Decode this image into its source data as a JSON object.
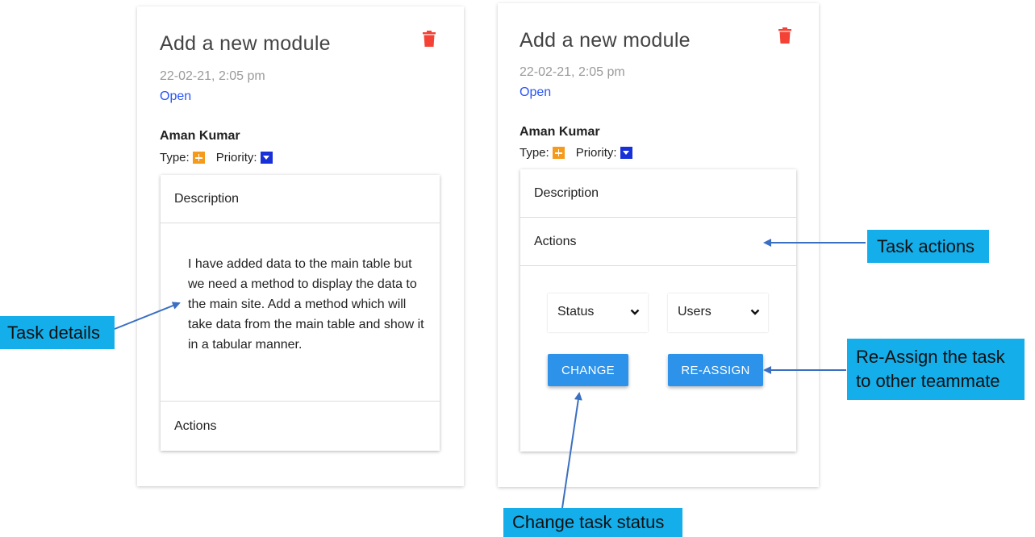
{
  "left_card": {
    "title": "Add a new module",
    "date": "22-02-21, 2:05 pm",
    "status": "Open",
    "user": "Aman Kumar",
    "type_label": "Type:",
    "priority_label": "Priority:",
    "description_header": "Description",
    "description_text": "I have added data to the main table but we need a method to display the data to the main site. Add a method which will take data from the main table and show it in a tabular manner.",
    "actions_header": "Actions"
  },
  "right_card": {
    "title": "Add a new module",
    "date": "22-02-21, 2:05 pm",
    "status": "Open",
    "user": "Aman Kumar",
    "type_label": "Type:",
    "priority_label": "Priority:",
    "description_header": "Description",
    "actions_header": "Actions",
    "status_select": "Status",
    "users_select": "Users",
    "change_button": "CHANGE",
    "reassign_button": "RE-ASSIGN"
  },
  "callouts": {
    "task_details": "Task details",
    "task_actions": "Task actions",
    "reassign_line1": "Re-Assign the task",
    "reassign_line2": "to other teammate",
    "change_status": "Change task status"
  },
  "colors": {
    "status_link": "#2a54f5",
    "delete_icon": "#f44336",
    "type_badge": "#f59a1b",
    "priority_badge": "#1730d8",
    "button": "#2d92ea",
    "callout_bg": "#14aeea",
    "arrow": "#3a6fc2"
  },
  "icons": [
    "trash-icon",
    "type-plus-icon",
    "priority-down-icon",
    "chevron-down-icon"
  ]
}
